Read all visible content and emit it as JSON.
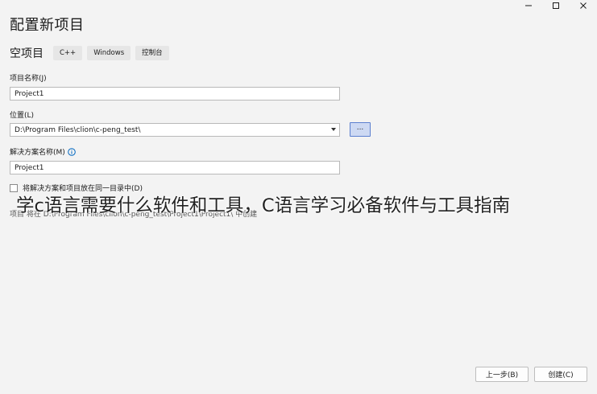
{
  "window": {
    "minimize_icon": "minimize-icon",
    "maximize_icon": "maximize-icon",
    "close_icon": "close-icon"
  },
  "page": {
    "title": "配置新项目"
  },
  "template": {
    "name": "空项目",
    "tags": [
      "C++",
      "Windows",
      "控制台"
    ]
  },
  "form": {
    "project_name_label": "项目名称(J)",
    "project_name_value": "Project1",
    "location_label": "位置(L)",
    "location_value": "D:\\Program Files\\clion\\c-peng_test\\",
    "browse_label": "...",
    "solution_name_label": "解决方案名称(M)",
    "solution_name_value": "Project1",
    "same_dir_label": "将解决方案和项目放在同一目录中(D)",
    "same_dir_checked": false,
    "project_path_text": "项目 将在 D:\\Program Files\\clion\\c-peng_test\\Project1\\Project1\\ 中创建"
  },
  "overlay": {
    "caption": "学c语言需要什么软件和工具，C语言学习必备软件与工具指南"
  },
  "footer": {
    "back_label": "上一步(B)",
    "create_label": "创建(C)"
  },
  "colors": {
    "background": "#f3f3f3",
    "accent_border": "#5b7fcf",
    "accent_fill": "#cdd9f3",
    "info_blue": "#0067c0"
  }
}
